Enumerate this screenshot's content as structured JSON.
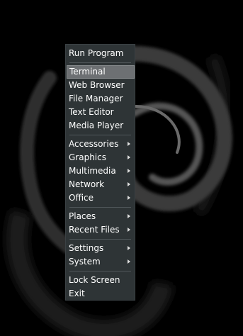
{
  "menu": {
    "items": [
      {
        "label": "Run Program",
        "submenu": false,
        "highlighted": false
      },
      {
        "label": "Terminal",
        "submenu": false,
        "highlighted": true
      },
      {
        "label": "Web Browser",
        "submenu": false,
        "highlighted": false
      },
      {
        "label": "File Manager",
        "submenu": false,
        "highlighted": false
      },
      {
        "label": "Text Editor",
        "submenu": false,
        "highlighted": false
      },
      {
        "label": "Media Player",
        "submenu": false,
        "highlighted": false
      },
      {
        "label": "Accessories",
        "submenu": true,
        "highlighted": false
      },
      {
        "label": "Graphics",
        "submenu": true,
        "highlighted": false
      },
      {
        "label": "Multimedia",
        "submenu": true,
        "highlighted": false
      },
      {
        "label": "Network",
        "submenu": true,
        "highlighted": false
      },
      {
        "label": "Office",
        "submenu": true,
        "highlighted": false
      },
      {
        "label": "Places",
        "submenu": true,
        "highlighted": false
      },
      {
        "label": "Recent Files",
        "submenu": true,
        "highlighted": false
      },
      {
        "label": "Settings",
        "submenu": true,
        "highlighted": false
      },
      {
        "label": "System",
        "submenu": true,
        "highlighted": false
      },
      {
        "label": "Lock Screen",
        "submenu": false,
        "highlighted": false
      },
      {
        "label": "Exit",
        "submenu": false,
        "highlighted": false
      }
    ]
  },
  "colors": {
    "desktop_background": "#000000",
    "wallpaper_swirl": "#3c3c3c",
    "menu_background": "#2e3436",
    "menu_highlight": "#6d7073",
    "menu_text": "#ffffff"
  },
  "icons": {
    "submenu_indicator": "triangle-right-icon",
    "wallpaper_logo": "debian-swirl-logo"
  }
}
